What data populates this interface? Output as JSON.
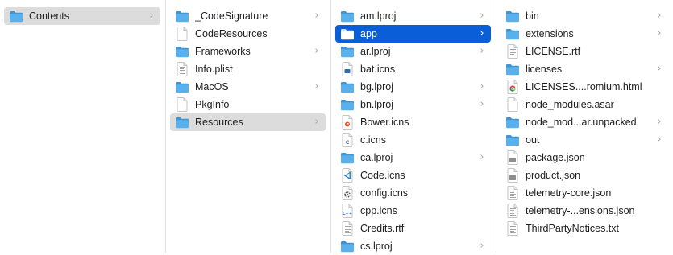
{
  "columns": [
    {
      "items": [
        {
          "label": "Contents",
          "icon": "folder-icon",
          "type": "folder",
          "disclosure": true,
          "selected": "gray"
        }
      ]
    },
    {
      "items": [
        {
          "label": "_CodeSignature",
          "icon": "folder-icon",
          "type": "folder",
          "disclosure": true,
          "selected": ""
        },
        {
          "label": "CodeResources",
          "icon": "blank-document-icon",
          "type": "blank",
          "disclosure": false,
          "selected": ""
        },
        {
          "label": "Frameworks",
          "icon": "folder-icon",
          "type": "folder",
          "disclosure": true,
          "selected": ""
        },
        {
          "label": "Info.plist",
          "icon": "text-document-icon",
          "type": "text",
          "disclosure": false,
          "selected": ""
        },
        {
          "label": "MacOS",
          "icon": "folder-icon",
          "type": "folder",
          "disclosure": true,
          "selected": ""
        },
        {
          "label": "PkgInfo",
          "icon": "blank-document-icon",
          "type": "blank",
          "disclosure": false,
          "selected": ""
        },
        {
          "label": "Resources",
          "icon": "folder-icon",
          "type": "folder",
          "disclosure": true,
          "selected": "gray"
        }
      ]
    },
    {
      "items": [
        {
          "label": "am.lproj",
          "icon": "folder-icon",
          "type": "folder",
          "disclosure": true,
          "selected": ""
        },
        {
          "label": "app",
          "icon": "folder-icon",
          "type": "folder",
          "disclosure": true,
          "selected": "blue"
        },
        {
          "label": "ar.lproj",
          "icon": "folder-icon",
          "type": "folder",
          "disclosure": true,
          "selected": ""
        },
        {
          "label": "bat.icns",
          "icon": "bat-icns-icon",
          "type": "icns",
          "badge": "box",
          "disclosure": false,
          "selected": ""
        },
        {
          "label": "bg.lproj",
          "icon": "folder-icon",
          "type": "folder",
          "disclosure": true,
          "selected": ""
        },
        {
          "label": "bn.lproj",
          "icon": "folder-icon",
          "type": "folder",
          "disclosure": true,
          "selected": ""
        },
        {
          "label": "Bower.icns",
          "icon": "bower-icns-icon",
          "type": "icns",
          "badge": "bower",
          "disclosure": false,
          "selected": ""
        },
        {
          "label": "c.icns",
          "icon": "c-icns-icon",
          "type": "icns",
          "badge": "C",
          "disclosure": false,
          "selected": ""
        },
        {
          "label": "ca.lproj",
          "icon": "folder-icon",
          "type": "folder",
          "disclosure": true,
          "selected": ""
        },
        {
          "label": "Code.icns",
          "icon": "vscode-icns-icon",
          "type": "icns",
          "badge": "vscode",
          "disclosure": false,
          "selected": ""
        },
        {
          "label": "config.icns",
          "icon": "config-icns-icon",
          "type": "icns",
          "badge": "gear",
          "disclosure": false,
          "selected": ""
        },
        {
          "label": "cpp.icns",
          "icon": "cpp-icns-icon",
          "type": "icns",
          "badge": "C++",
          "disclosure": false,
          "selected": ""
        },
        {
          "label": "Credits.rtf",
          "icon": "text-document-icon",
          "type": "text",
          "disclosure": false,
          "selected": ""
        },
        {
          "label": "cs.lproj",
          "icon": "folder-icon",
          "type": "folder",
          "disclosure": true,
          "selected": ""
        }
      ]
    },
    {
      "items": [
        {
          "label": "bin",
          "icon": "folder-icon",
          "type": "folder",
          "disclosure": true,
          "selected": ""
        },
        {
          "label": "extensions",
          "icon": "folder-icon",
          "type": "folder",
          "disclosure": true,
          "selected": ""
        },
        {
          "label": "LICENSE.rtf",
          "icon": "text-document-icon",
          "type": "text",
          "disclosure": false,
          "selected": ""
        },
        {
          "label": "licenses",
          "icon": "folder-icon",
          "type": "folder",
          "disclosure": true,
          "selected": ""
        },
        {
          "label": "LICENSES....romium.html",
          "icon": "chrome-html-icon",
          "type": "html",
          "disclosure": false,
          "selected": ""
        },
        {
          "label": "node_modules.asar",
          "icon": "blank-document-icon",
          "type": "blank",
          "disclosure": false,
          "selected": ""
        },
        {
          "label": "node_mod...ar.unpacked",
          "icon": "folder-icon",
          "type": "folder",
          "disclosure": true,
          "selected": ""
        },
        {
          "label": "out",
          "icon": "folder-icon",
          "type": "folder",
          "disclosure": true,
          "selected": ""
        },
        {
          "label": "package.json",
          "icon": "json-document-icon",
          "type": "json",
          "disclosure": false,
          "selected": ""
        },
        {
          "label": "product.json",
          "icon": "json-document-icon",
          "type": "json",
          "disclosure": false,
          "selected": ""
        },
        {
          "label": "telemetry-core.json",
          "icon": "text-document-icon",
          "type": "text",
          "disclosure": false,
          "selected": ""
        },
        {
          "label": "telemetry-...ensions.json",
          "icon": "text-document-icon",
          "type": "text",
          "disclosure": false,
          "selected": ""
        },
        {
          "label": "ThirdPartyNotices.txt",
          "icon": "text-document-icon",
          "type": "text",
          "disclosure": false,
          "selected": ""
        }
      ]
    }
  ],
  "colors": {
    "folder_body": "#5ab0ea",
    "folder_top": "#3d95d6",
    "selection_blue": "#0a5fd9",
    "selection_gray": "#dcdcdc",
    "chevron": "#a6a6a6"
  }
}
